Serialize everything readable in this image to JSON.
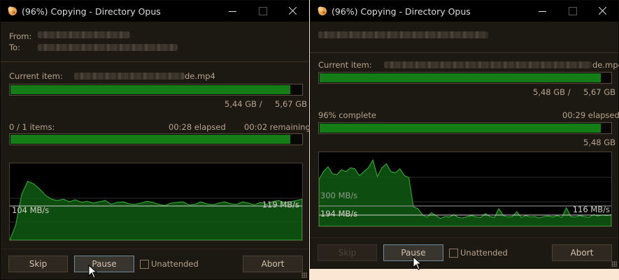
{
  "left": {
    "title": "(96%) Copying - Directory Opus",
    "from_label": "From:",
    "to_label": "To:",
    "current_item_label": "Current item:",
    "current_item_name": "de.mp4",
    "item_progress": 0.962,
    "item_size_copied": "5,44 GB /",
    "item_size_total": "5,67 GB",
    "items_label": "0 / 1 items:",
    "elapsed": "00:28 elapsed",
    "remaining": "00:02 remaining",
    "total_progress": 0.962,
    "graph": {
      "avg_speed": "104 MB/s",
      "current_speed": "119 MB/s",
      "series": [
        0,
        60,
        180,
        230,
        220,
        200,
        175,
        160,
        155,
        160,
        150,
        158,
        148,
        152,
        145,
        150,
        155,
        140,
        148,
        150,
        142,
        140,
        145,
        152,
        148,
        140,
        135,
        145,
        148,
        150,
        138,
        140,
        150,
        142,
        138,
        145,
        150,
        142,
        140,
        150,
        145,
        138,
        148,
        140,
        150,
        155,
        148,
        150,
        155,
        160
      ]
    },
    "buttons": {
      "skip": "Skip",
      "pause": "Pause",
      "abort": "Abort"
    },
    "unattended_label": "Unattended"
  },
  "right": {
    "title": "(96%) Copying - Directory Opus",
    "current_item_label": "Current item:",
    "current_item_name": "de.mp4",
    "item_progress": 0.966,
    "item_size_copied": "5,48 GB /",
    "item_size_total": "5,67 GB",
    "percent_label": "96% complete",
    "elapsed": "00:29 elapsed",
    "total_progress": 0.966,
    "total_size": "5,48 GB",
    "graph": {
      "peak_speed": "300 MB/s",
      "avg_speed": "194 MB/s",
      "current_speed": "116 MB/s",
      "series": [
        480,
        560,
        610,
        540,
        530,
        580,
        560,
        600,
        590,
        520,
        560,
        600,
        680,
        510,
        600,
        640,
        560,
        550,
        590,
        520,
        500,
        200,
        180,
        120,
        90,
        140,
        110,
        80,
        100,
        95,
        120,
        90,
        85,
        100,
        110,
        95,
        90,
        130,
        100,
        90,
        180,
        110,
        95,
        100,
        150,
        90,
        110,
        95,
        100,
        85,
        100,
        105,
        95,
        110,
        90,
        190,
        100,
        95,
        110,
        100,
        90,
        120,
        105,
        115,
        110,
        120
      ]
    },
    "buttons": {
      "skip": "Skip",
      "pause": "Pause",
      "abort": "Abort"
    },
    "unattended_label": "Unattended"
  }
}
